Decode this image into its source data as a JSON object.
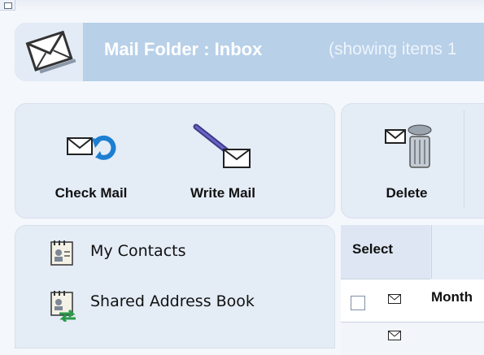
{
  "folder_bar": {
    "title": "Mail Folder : Inbox",
    "subtitle": "(showing items 1"
  },
  "toolbar": {
    "check_mail_label": "Check Mail",
    "write_mail_label": "Write Mail",
    "delete_label": "Delete"
  },
  "nav": {
    "items": [
      {
        "label": "My Contacts",
        "icon": "contacts-card-icon"
      },
      {
        "label": "Shared Address Book",
        "icon": "shared-address-book-icon"
      }
    ]
  },
  "message_table": {
    "header_select": "Select",
    "rows": [
      {
        "subject": "Month"
      }
    ]
  },
  "colors": {
    "folder_bar": "#b8d0e8",
    "panel": "#e4ecf6",
    "background": "#f4f7fb"
  }
}
